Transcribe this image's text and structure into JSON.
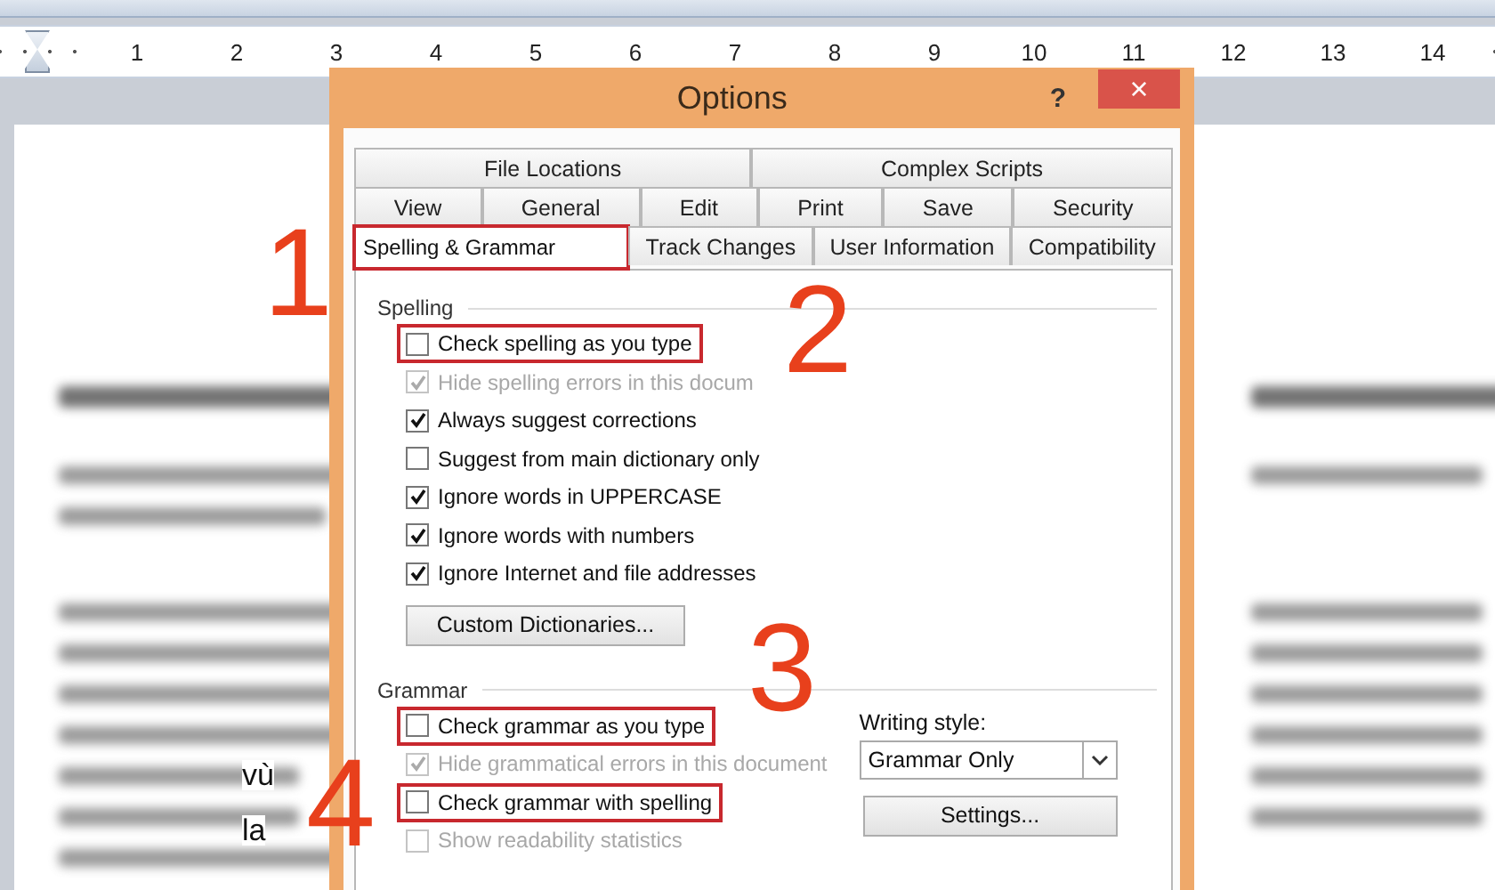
{
  "ruler": {
    "numbers": [
      "1",
      "2",
      "3",
      "4",
      "5",
      "6",
      "7",
      "8",
      "9",
      "10",
      "11",
      "12",
      "13",
      "14"
    ]
  },
  "document": {
    "fragments": [
      "vù",
      "la"
    ]
  },
  "dialog": {
    "title": "Options",
    "help": "?",
    "close": "×",
    "tab_rows": [
      [
        {
          "label": "File Locations",
          "selected": false,
          "highlighted": false
        },
        {
          "label": "Complex Scripts",
          "selected": false,
          "highlighted": false
        }
      ],
      [
        {
          "label": "View",
          "selected": false,
          "highlighted": false
        },
        {
          "label": "General",
          "selected": false,
          "highlighted": false
        },
        {
          "label": "Edit",
          "selected": false,
          "highlighted": false
        },
        {
          "label": "Print",
          "selected": false,
          "highlighted": false
        },
        {
          "label": "Save",
          "selected": false,
          "highlighted": false
        },
        {
          "label": "Security",
          "selected": false,
          "highlighted": false
        }
      ],
      [
        {
          "label": "Spelling & Grammar",
          "selected": true,
          "highlighted": true
        },
        {
          "label": "Track Changes",
          "selected": false,
          "highlighted": false
        },
        {
          "label": "User Information",
          "selected": false,
          "highlighted": false
        },
        {
          "label": "Compatibility",
          "selected": false,
          "highlighted": false
        }
      ]
    ],
    "spelling": {
      "heading": "Spelling",
      "options": [
        {
          "label": "Check spelling as you type",
          "checked": false,
          "disabled": false,
          "highlighted": true
        },
        {
          "label": "Hide spelling errors in this docum",
          "checked": true,
          "disabled": true,
          "highlighted": false
        },
        {
          "label": "Always suggest corrections",
          "checked": true,
          "disabled": false,
          "highlighted": false
        },
        {
          "label": "Suggest from main dictionary only",
          "checked": false,
          "disabled": false,
          "highlighted": false
        },
        {
          "label": "Ignore words in UPPERCASE",
          "checked": true,
          "disabled": false,
          "highlighted": false
        },
        {
          "label": "Ignore words with numbers",
          "checked": true,
          "disabled": false,
          "highlighted": false
        },
        {
          "label": "Ignore Internet and file addresses",
          "checked": true,
          "disabled": false,
          "highlighted": false
        }
      ],
      "button": "Custom Dictionaries..."
    },
    "grammar": {
      "heading": "Grammar",
      "options": [
        {
          "label": "Check grammar as you type",
          "checked": false,
          "disabled": false,
          "highlighted": true
        },
        {
          "label": "Hide grammatical errors in this document",
          "checked": true,
          "disabled": true,
          "highlighted": false
        },
        {
          "label": "Check grammar with spelling",
          "checked": false,
          "disabled": false,
          "highlighted": true
        },
        {
          "label": "Show readability statistics",
          "checked": false,
          "disabled": true,
          "highlighted": false
        }
      ],
      "writing_style_label": "Writing style:",
      "writing_style_value": "Grammar Only",
      "settings_button": "Settings..."
    }
  },
  "annotations": [
    "1",
    "2",
    "3",
    "4"
  ]
}
